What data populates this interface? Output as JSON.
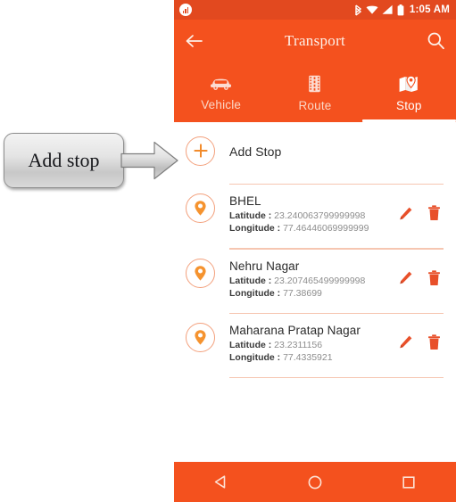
{
  "annotation": {
    "callout_label": "Add stop",
    "arrow_icon": "right-arrow-icon"
  },
  "status_bar": {
    "time": "1:05 AM",
    "icons": [
      "app-notification-icon",
      "bluetooth-icon",
      "wifi-icon",
      "signal-icon",
      "battery-icon"
    ],
    "background_color": "#e2491f"
  },
  "toolbar": {
    "title": "Transport",
    "back_icon": "arrow-back-icon",
    "search_icon": "search-icon",
    "background_color": "#f4511e"
  },
  "tabs": {
    "active_index": 2,
    "items": [
      {
        "label": "Vehicle",
        "icon": "car-icon"
      },
      {
        "label": "Route",
        "icon": "road-icon"
      },
      {
        "label": "Stop",
        "icon": "map-pin-icon"
      }
    ]
  },
  "list": {
    "add_stop": {
      "label": "Add Stop",
      "icon": "plus-icon"
    },
    "latitude_label": "Latitude :",
    "longitude_label": "Longitude :",
    "edit_icon": "pencil-icon",
    "delete_icon": "trash-icon",
    "stops": [
      {
        "name": "BHEL",
        "latitude": "23.240063799999998",
        "longitude": "77.46446069999999"
      },
      {
        "name": "Nehru Nagar",
        "latitude": "23.207465499999998",
        "longitude": "77.38699"
      },
      {
        "name": "Maharana Pratap Nagar",
        "latitude": "23.2311156",
        "longitude": "77.4335921"
      }
    ]
  },
  "nav_bar": {
    "buttons": [
      {
        "name": "back",
        "icon": "triangle-back-icon"
      },
      {
        "name": "home",
        "icon": "circle-home-icon"
      },
      {
        "name": "recents",
        "icon": "square-recents-icon"
      }
    ],
    "background_color": "#f4511e"
  },
  "theme": {
    "accent": "#f4511e",
    "accent_dark": "#e2491f",
    "divider": "#f6c6b1",
    "icon_orange": "#f28b2b",
    "action_red": "#e8502a"
  }
}
